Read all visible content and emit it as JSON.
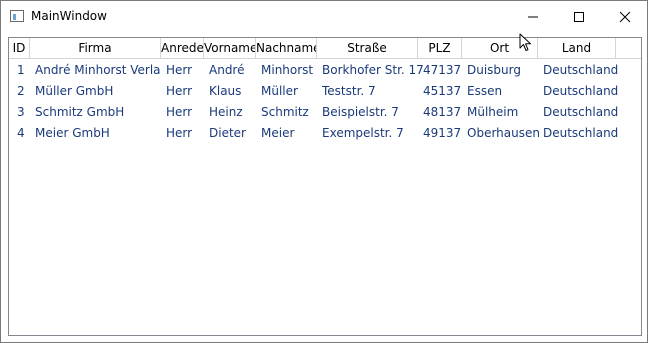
{
  "window": {
    "title": "MainWindow"
  },
  "icons": {
    "app": "window-app-icon",
    "minimize": "minimize-icon",
    "maximize": "maximize-icon",
    "close": "close-icon",
    "cursor": "mouse-pointer-icon"
  },
  "grid": {
    "columns": [
      "ID",
      "Firma",
      "Anrede",
      "Vorname",
      "Nachname",
      "Straße",
      "PLZ",
      "Ort",
      "Land"
    ],
    "rows": [
      [
        "1",
        "André Minhorst Verlag",
        "Herr",
        "André",
        "Minhorst",
        "Borkhofer Str. 17",
        "47137",
        "Duisburg",
        "Deutschland"
      ],
      [
        "2",
        "Müller GmbH",
        "Herr",
        "Klaus",
        "Müller",
        "Teststr. 7",
        "45137",
        "Essen",
        "Deutschland"
      ],
      [
        "3",
        "Schmitz GmbH",
        "Herr",
        "Heinz",
        "Schmitz",
        "Beispielstr. 7",
        "48137",
        "Mülheim",
        "Deutschland"
      ],
      [
        "4",
        "Meier GmbH",
        "Herr",
        "Dieter",
        "Meier",
        "Exempelstr. 7",
        "49137",
        "Oberhausen",
        "Deutschland"
      ]
    ]
  },
  "colors": {
    "cell_text": "#1a3a7a",
    "border": "#828790",
    "gridline": "#d5d5d5"
  }
}
